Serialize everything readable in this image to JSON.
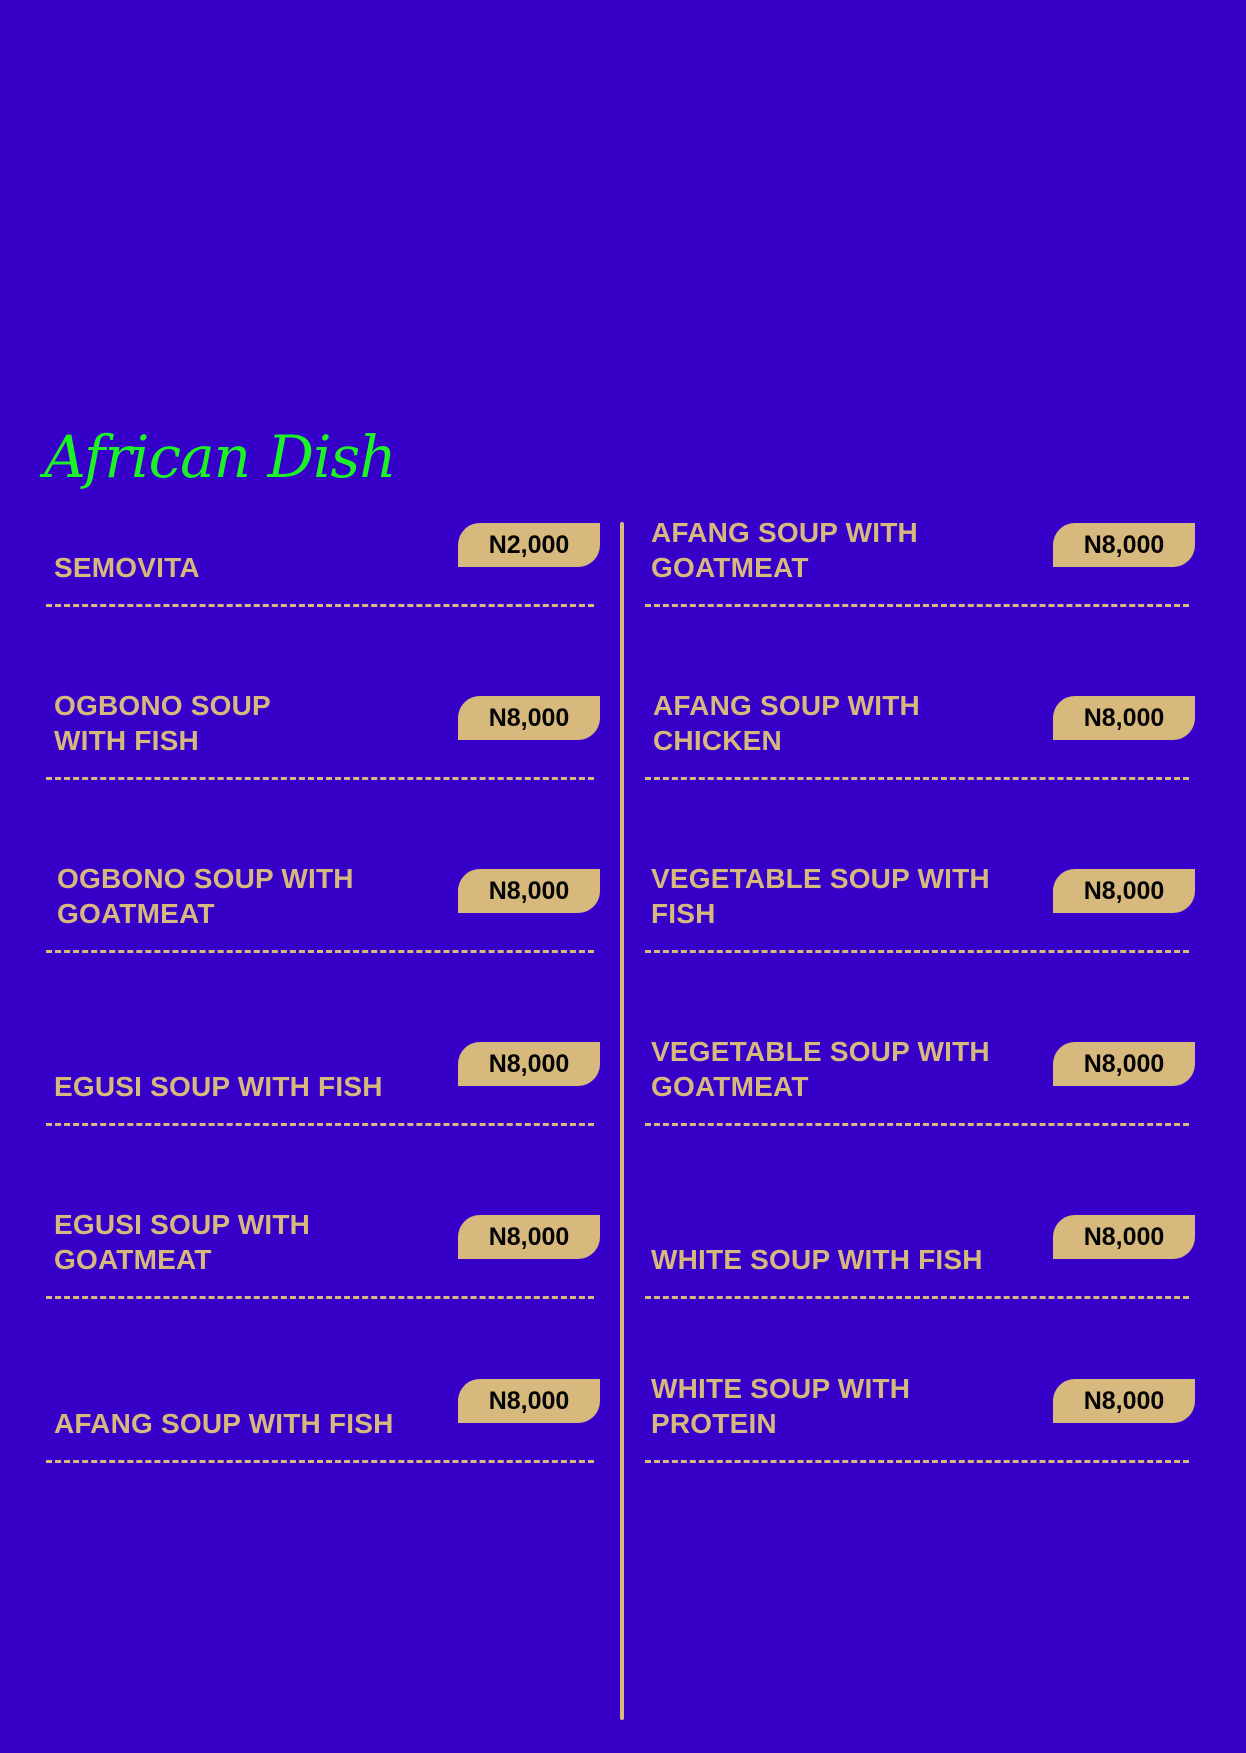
{
  "section": {
    "title": "African Dish"
  },
  "colors": {
    "background": "#3700c9",
    "accent_gold": "#d7b97d",
    "title_green": "#1cf226"
  },
  "menu": {
    "left": [
      {
        "name": "SEMOVITA",
        "price": "N2,000"
      },
      {
        "name": "OGBONO SOUP WITH FISH",
        "price": "N8,000"
      },
      {
        "name": "OGBONO SOUP WITH GOATMEAT",
        "price": "N8,000"
      },
      {
        "name": "EGUSI SOUP WITH FISH",
        "price": "N8,000"
      },
      {
        "name": "EGUSI SOUP WITH GOATMEAT",
        "price": "N8,000"
      },
      {
        "name": "AFANG SOUP WITH FISH",
        "price": "N8,000"
      }
    ],
    "right": [
      {
        "name": "AFANG SOUP WITH GOATMEAT",
        "price": "N8,000"
      },
      {
        "name": "AFANG SOUP WITH CHICKEN",
        "price": "N8,000"
      },
      {
        "name": "VEGETABLE SOUP WITH FISH",
        "price": "N8,000"
      },
      {
        "name": "VEGETABLE SOUP WITH GOATMEAT",
        "price": "N8,000"
      },
      {
        "name": "WHITE SOUP WITH FISH",
        "price": "N8,000"
      },
      {
        "name": "WHITE SOUP WITH PROTEIN",
        "price": "N8,000"
      }
    ]
  }
}
